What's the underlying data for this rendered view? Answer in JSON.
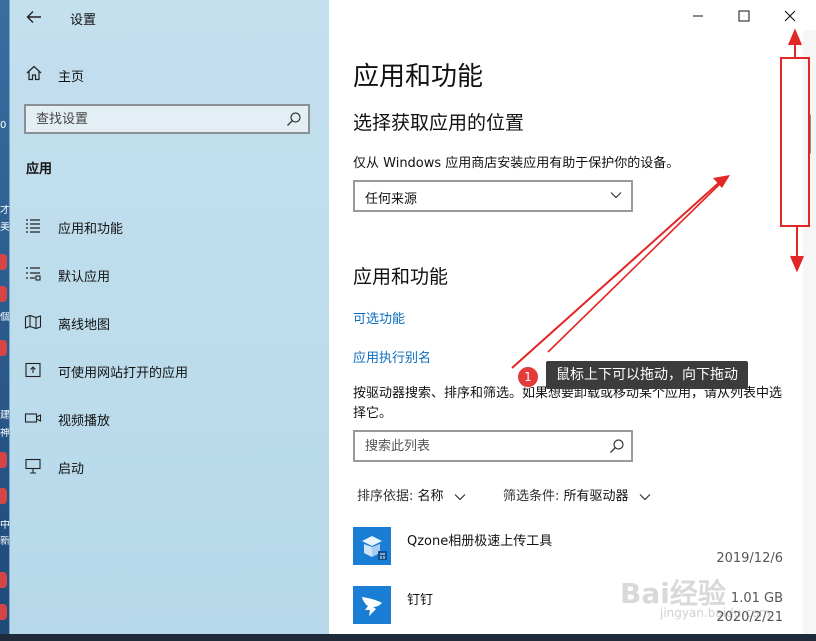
{
  "window": {
    "title": "设置",
    "controls": {
      "minimize": "—",
      "maximize": "☐",
      "close": "✕"
    }
  },
  "sidebar": {
    "home_label": "主页",
    "search_placeholder": "查找设置",
    "section": "应用",
    "items": [
      {
        "label": "应用和功能",
        "icon": "list-icon"
      },
      {
        "label": "默认应用",
        "icon": "default-apps-icon"
      },
      {
        "label": "离线地图",
        "icon": "map-icon"
      },
      {
        "label": "可使用网站打开的应用",
        "icon": "website-app-icon"
      },
      {
        "label": "视频播放",
        "icon": "video-icon"
      },
      {
        "label": "启动",
        "icon": "startup-icon"
      }
    ]
  },
  "main": {
    "page_title": "应用和功能",
    "location_heading": "选择获取应用的位置",
    "location_desc": "仅从 Windows 应用商店安装应用有助于保护你的设备。",
    "location_select": "任何来源",
    "apps_heading": "应用和功能",
    "link_optional": "可选功能",
    "link_alias": "应用执行别名",
    "body": "按驱动器搜索、排序和筛选。如果想要卸载或移动某个应用，请从列表中选择它。",
    "list_search_placeholder": "搜索此列表",
    "sort_label": "排序依据:",
    "sort_value": "名称",
    "filter_label": "筛选条件:",
    "filter_value": "所有驱动器",
    "apps": [
      {
        "name": "Qzone相册极速上传工具",
        "size": "",
        "date": "2019/12/6"
      },
      {
        "name": "钉钉",
        "size": "1.01 GB",
        "date": "2020/2/21"
      }
    ]
  },
  "annotation": {
    "number": "1",
    "tip": "鼠标上下可以拖动，向下拖动"
  },
  "watermark": {
    "brand": "Bai经验",
    "url": "jingyan.baidu.com"
  },
  "colors": {
    "accent_link": "#0a6cc0",
    "sidebar_bg": "#bcdcec",
    "annotation_red": "#e33a3a"
  }
}
